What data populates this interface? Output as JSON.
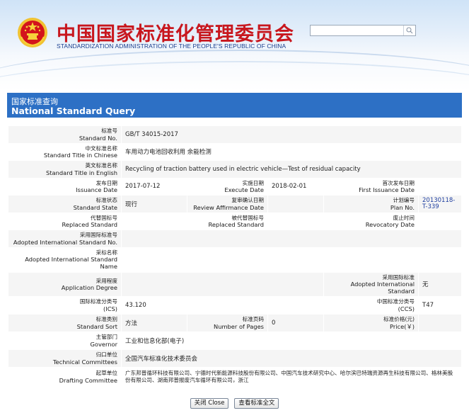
{
  "header": {
    "title_cn": "中国国家标准化管理委员会",
    "title_en": "STANDARDIZATION ADMINISTRATION OF THE PEOPLE'S REPUBLIC OF CHINA",
    "search_value": "",
    "emblem_icon": "national-emblem-icon",
    "search_icon": "search-icon"
  },
  "query_bar": {
    "title_cn": "国家标准查询",
    "title_en": "National Standard Query"
  },
  "fields": {
    "standard_no": {
      "cn": "标准号",
      "en": "Standard No.",
      "value": "GB/T 34015-2017"
    },
    "title_cn": {
      "cn": "中文标准名称",
      "en": "Standard Title in Chinese",
      "value": "车用动力电池回收利用 余能检测"
    },
    "title_en": {
      "cn": "英文标准名称",
      "en": "Standard Title in English",
      "value": "Recycling of traction battery used in electric vehicle—Test of residual capacity"
    },
    "issuance_date": {
      "cn": "发布日期",
      "en": "Issuance Date",
      "value": "2017-07-12"
    },
    "execute_date": {
      "cn": "实施日期",
      "en": "Execute Date",
      "value": "2018-02-01"
    },
    "first_issuance_date": {
      "cn": "首次发布日期",
      "en": "First Issuance Date",
      "value": ""
    },
    "standard_state": {
      "cn": "标准状态",
      "en": "Standard State",
      "value": "现行"
    },
    "review_date": {
      "cn": "复审确认日期",
      "en": "Review Affirmance Date",
      "value": ""
    },
    "plan_no": {
      "cn": "计划编号",
      "en": "Plan No.",
      "value": "20130118-T-339"
    },
    "replaced_standard": {
      "cn": "代替国标号",
      "en": "Replaced Standard",
      "value": ""
    },
    "replaced_by": {
      "cn": "被代替国标号",
      "en": "Replaced Standard",
      "value": ""
    },
    "revocatory_date": {
      "cn": "废止时间",
      "en": "Revocatory Date",
      "value": ""
    },
    "adopted_intl_no": {
      "cn": "采用国际标准号",
      "en": "Adopted International Standard No.",
      "value": ""
    },
    "adopted_intl_name": {
      "cn": "采标名称",
      "en": "Adopted International Standard Name",
      "value": ""
    },
    "application_degree": {
      "cn": "采用程度",
      "en": "Application Degree",
      "value": ""
    },
    "adopted_intl_standard": {
      "cn": "采用国际标准",
      "en": "Adopted International Standard",
      "value": "无"
    },
    "ics": {
      "cn": "国际标准分类号",
      "en": "(ICS)",
      "value": "43.120"
    },
    "ccs": {
      "cn": "中国标准分类号",
      "en": "(CCS)",
      "value": "T47"
    },
    "standard_sort": {
      "cn": "标准类别",
      "en": "Standard Sort",
      "value": "方法"
    },
    "number_of_pages": {
      "cn": "标准页码",
      "en": "Number of Pages",
      "value": "0"
    },
    "price": {
      "cn": "标准价格(元)",
      "en": "Price(￥)",
      "value": ""
    },
    "governor": {
      "cn": "主管部门",
      "en": "Governor",
      "value": "工业和信息化部(电子)"
    },
    "technical_committees": {
      "cn": "归口单位",
      "en": "Technical Committees",
      "value": "全国汽车标准化技术委员会"
    },
    "drafting_committee": {
      "cn": "起草单位",
      "en": "Drafting Committee",
      "value": "广东邦普循环科技有限公司、宁德时代新能源科技股份有限公司、中国汽车技术研究中心、哈尔滨巴特瑞资源再生科技有限公司、格林美股份有限公司、湖南邦普报废汽车循环有限公司，浙江"
    }
  },
  "buttons": {
    "close": "关闭 Close",
    "view_full": "查看标准全文"
  },
  "colors": {
    "brand_red": "#c8171e",
    "brand_blue": "#2d70c5",
    "english_title_blue": "#1b3f8f"
  }
}
